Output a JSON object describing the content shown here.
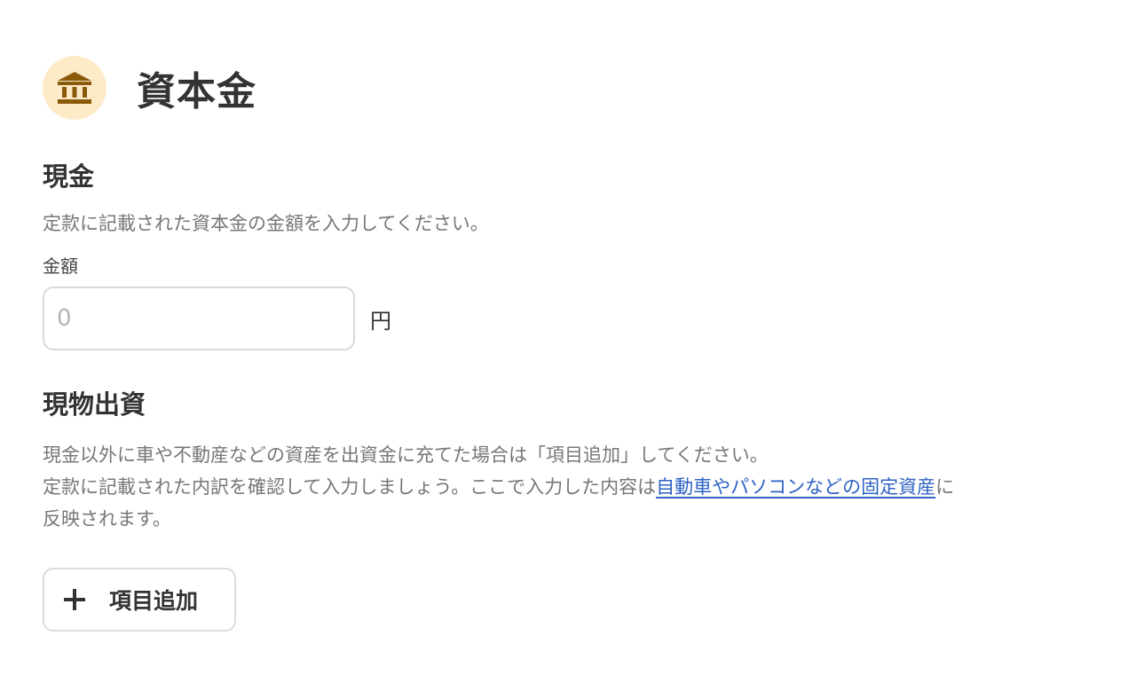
{
  "header": {
    "icon": "bank-icon",
    "title": "資本金"
  },
  "cash": {
    "heading": "現金",
    "description": "定款に記載された資本金の金額を入力してください。",
    "amount_label": "金額",
    "amount_value": "",
    "amount_placeholder": "0",
    "unit": "円"
  },
  "in_kind": {
    "heading": "現物出資",
    "description_line1": "現金以外に車や不動産などの資産を出資金に充てた場合は「項目追加」してください。",
    "description_line2_before": "定款に記載された内訳を確認して入力しましょう。ここで入力した内容は",
    "description_link": "自動車やパソコンなどの固定資産",
    "description_line2_after": "に",
    "description_line3": "反映されます。",
    "add_button_icon": "plus-icon",
    "add_button_label": "項目追加"
  },
  "colors": {
    "icon_background": "#fdebc8",
    "icon_color": "#8a5a0b",
    "link": "#2f63c4",
    "text_primary": "#333333",
    "text_secondary": "#777777"
  }
}
